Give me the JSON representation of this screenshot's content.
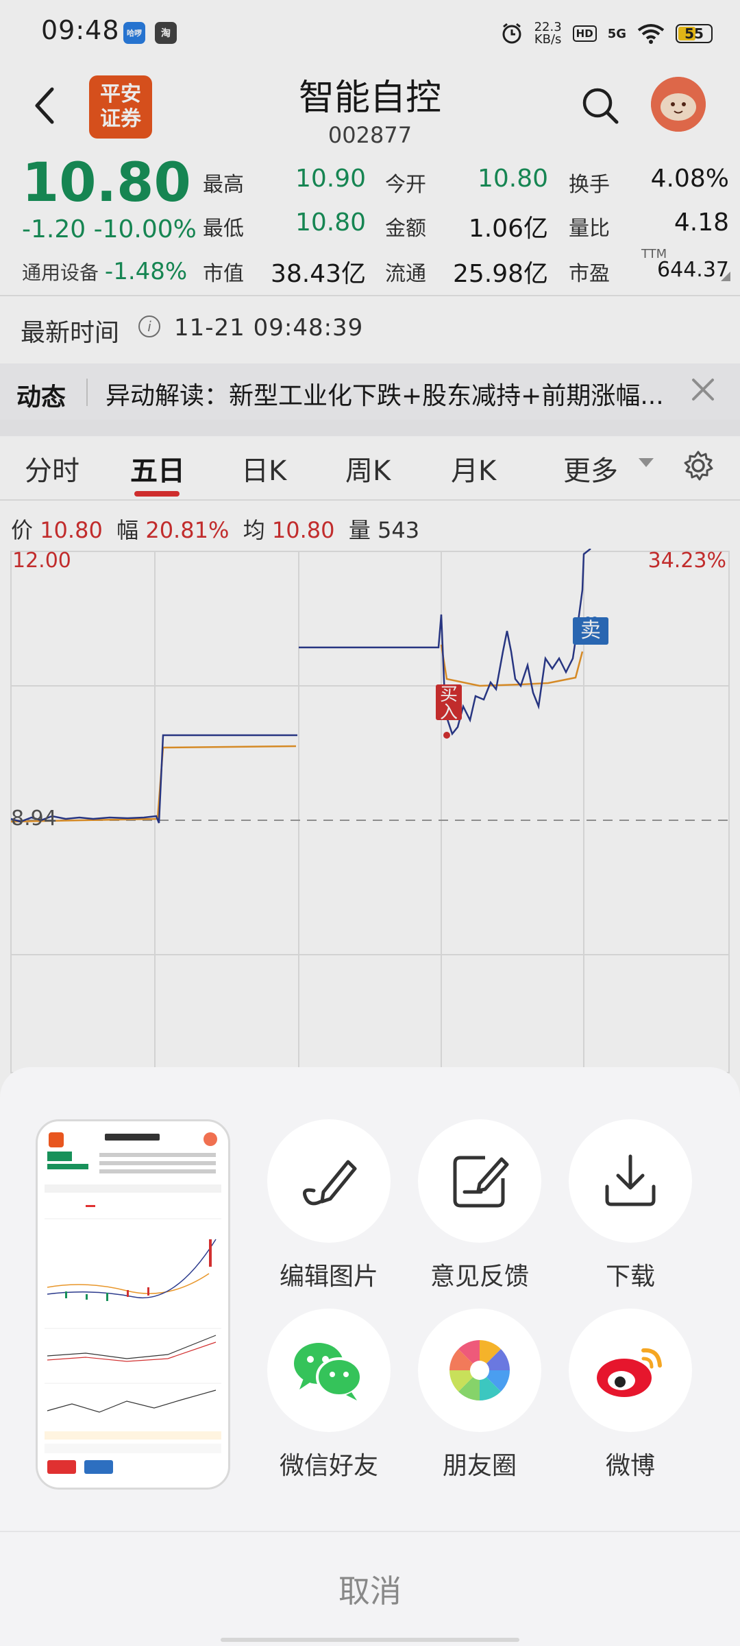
{
  "status_bar": {
    "time": "09:48",
    "app_icon_1": "哈啰",
    "app_icon_2": "淘",
    "net_speed_value": "22.3",
    "net_speed_unit": "KB/s",
    "hd_label": "HD",
    "network_label": "5G",
    "battery_level": "55",
    "battery_fill_fraction": 0.55
  },
  "header": {
    "logo_line1": "平安",
    "logo_line2": "证券",
    "stock_name": "智能自控",
    "stock_code": "002877"
  },
  "quote": {
    "price": "10.80",
    "change": "-1.20",
    "change_pct": "-10.00%",
    "industry_name": "通用设备",
    "industry_change": "-1.48%",
    "fields": [
      {
        "label": "最高",
        "value": "10.90",
        "color": "green"
      },
      {
        "label": "今开",
        "value": "10.80",
        "color": "green"
      },
      {
        "label": "换手",
        "value": "4.08%",
        "color": "dark"
      },
      {
        "label": "最低",
        "value": "10.80",
        "color": "green"
      },
      {
        "label": "金额",
        "value": "1.06亿",
        "color": "dark"
      },
      {
        "label": "量比",
        "value": "4.18",
        "color": "dark"
      },
      {
        "label": "市值",
        "value": "38.43亿",
        "color": "dark"
      },
      {
        "label": "流通",
        "value": "25.98亿",
        "color": "dark"
      },
      {
        "label": "市盈",
        "value": "644.37",
        "color": "dark"
      }
    ],
    "ttm_label": "TTM"
  },
  "latest": {
    "label": "最新时间",
    "info_icon": "i",
    "time": "11-21 09:48:39"
  },
  "news": {
    "tag": "动态",
    "text": "异动解读：新型工业化下跌+股东减持+前期涨幅..."
  },
  "tabs": [
    {
      "label": "分时",
      "active": false
    },
    {
      "label": "五日",
      "active": true
    },
    {
      "label": "日K",
      "active": false
    },
    {
      "label": "周K",
      "active": false
    },
    {
      "label": "月K",
      "active": false
    },
    {
      "label": "更多",
      "active": false
    }
  ],
  "chart_info": {
    "price_label": "价",
    "price_value": "10.80",
    "range_label": "幅",
    "range_value": "20.81%",
    "avg_label": "均",
    "avg_value": "10.80",
    "vol_label": "量",
    "vol_value": "543"
  },
  "chart_data": {
    "type": "line",
    "y_top_label": "12.00",
    "y_top_pct_label": "34.23%",
    "y_ref_label": "8.94",
    "ylim": [
      8.94,
      12.0
    ],
    "days": 5,
    "series": [],
    "markers": {
      "buy_label": "买入",
      "sell_label": "卖"
    }
  },
  "share_sheet": {
    "actions": [
      {
        "label": "编辑图片",
        "icon": "edit-pen-icon"
      },
      {
        "label": "意见反馈",
        "icon": "feedback-icon"
      },
      {
        "label": "下载",
        "icon": "download-icon"
      },
      {
        "label": "微信好友",
        "icon": "wechat-icon"
      },
      {
        "label": "朋友圈",
        "icon": "moments-icon"
      },
      {
        "label": "微博",
        "icon": "weibo-icon"
      }
    ],
    "cancel_label": "取消"
  },
  "colors": {
    "down_green": "#18915a",
    "up_red": "#d23030",
    "price_line": "#2b3a8c",
    "avg_line": "#e8962a",
    "brand_orange": "#e8561f"
  }
}
